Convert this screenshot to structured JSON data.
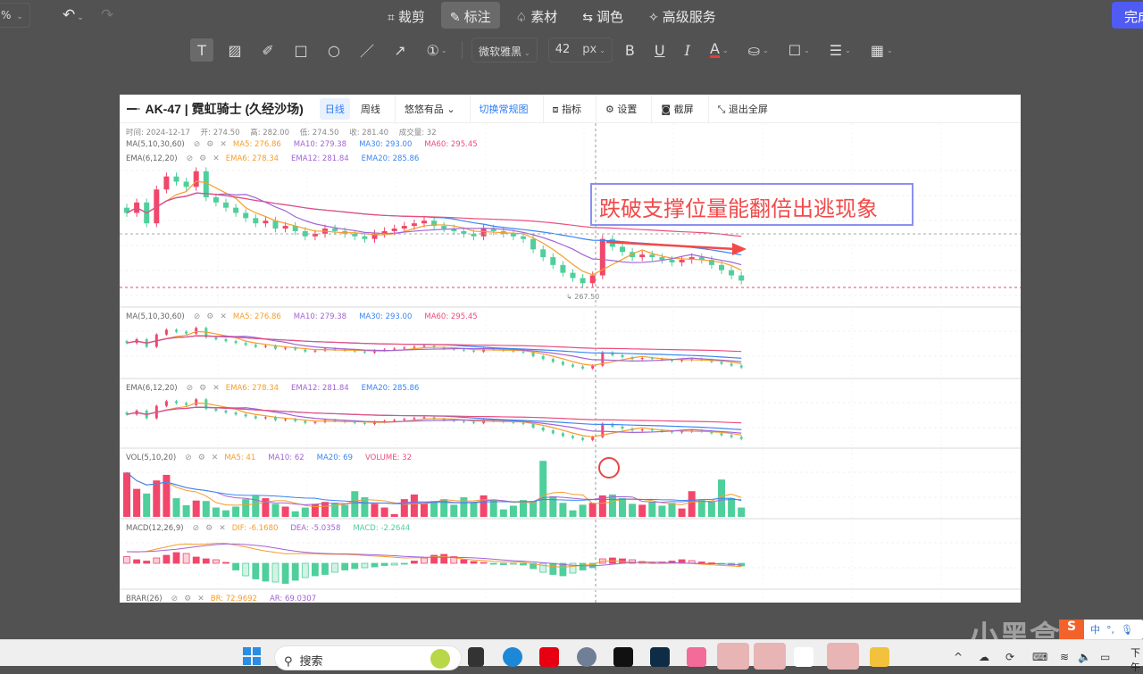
{
  "editor": {
    "zoom_value": "%",
    "modes": [
      {
        "icon": "crop-icon",
        "glyph": "⌗",
        "label": "裁剪",
        "active": false
      },
      {
        "icon": "annotate-icon",
        "glyph": "✎",
        "label": "标注",
        "active": true
      },
      {
        "icon": "material-icon",
        "glyph": "♤",
        "label": "素材",
        "active": false
      },
      {
        "icon": "adjust-color-icon",
        "glyph": "⇆",
        "label": "调色",
        "active": false
      },
      {
        "icon": "premium-icon",
        "glyph": "✧",
        "label": "高级服务",
        "active": false
      }
    ],
    "done_label": "完成",
    "tools": [
      {
        "name": "text-tool",
        "glyph": "T",
        "active": true
      },
      {
        "name": "image-tool",
        "glyph": "▨"
      },
      {
        "name": "brush-tool",
        "glyph": "✐"
      },
      {
        "name": "rectangle-tool",
        "glyph": "□"
      },
      {
        "name": "ellipse-tool",
        "glyph": "○"
      },
      {
        "name": "line-tool",
        "glyph": "／"
      },
      {
        "name": "arrow-tool",
        "glyph": "↗"
      },
      {
        "name": "number-tool",
        "glyph": "①"
      }
    ],
    "font_family": "微软雅黑",
    "font_size": "42",
    "font_unit": "px",
    "format": {
      "bold": "B",
      "underline": "U",
      "italic": "I",
      "color": "A",
      "text_color_hex": "#e83a3a"
    }
  },
  "chart_window": {
    "title": "AK-47 | 霓虹骑士 (久经沙场)",
    "tabs": [
      {
        "label": "日线",
        "active": true
      },
      {
        "label": "周线",
        "active": false
      }
    ],
    "source_select": "悠悠有品",
    "switch_view": "切换常规图",
    "toolbar": [
      {
        "icon": "indicator-icon",
        "glyph": "⧈",
        "label": "指标"
      },
      {
        "icon": "gear-icon",
        "glyph": "⚙",
        "label": "设置"
      },
      {
        "icon": "camera-icon",
        "glyph": "◙",
        "label": "截屏"
      },
      {
        "icon": "exit-fullscreen-icon",
        "glyph": "⤡",
        "label": "退出全屏"
      }
    ],
    "info": {
      "time": "时间: 2024-12-17",
      "open": "开: 274.50",
      "high": "高: 282.00",
      "low": "低: 274.50",
      "close": "收: 281.40",
      "volume": "成交量: 32"
    },
    "indicators": {
      "ma_main": {
        "name": "MA(5,10,30,60)",
        "values": [
          "MA5: 276.86",
          "MA10: 279.38",
          "MA30: 293.00",
          "MA60: 295.45"
        ]
      },
      "ema_main": {
        "name": "EMA(6,12,20)",
        "values": [
          "EMA6: 278.34",
          "EMA12: 281.84",
          "EMA20: 285.86"
        ]
      },
      "ma_panel": {
        "name": "MA(5,10,30,60)",
        "values": [
          "MA5: 276.86",
          "MA10: 279.38",
          "MA30: 293.00",
          "MA60: 295.45"
        ]
      },
      "ema_panel": {
        "name": "EMA(6,12,20)",
        "values": [
          "EMA6: 278.34",
          "EMA12: 281.84",
          "EMA20: 285.86"
        ]
      },
      "vol": {
        "name": "VOL(5,10,20)",
        "values": [
          "MA5: 41",
          "MA10: 62",
          "MA20: 69",
          "VOLUME: 32"
        ]
      },
      "macd": {
        "name": "MACD(12,26,9)",
        "values": [
          "DIF: -6.1680",
          "DEA: -5.0358",
          "MACD: -2.2644"
        ]
      },
      "brar": {
        "name": "BRAR(26)",
        "values": [
          "BR: 72.9692",
          "AR: 69.0307"
        ]
      }
    },
    "low_marker": "267.50",
    "annotation_text": "跌破支撑位量能翻倍出逃现象",
    "colors": {
      "up": "#f2466b",
      "down": "#4fcf9b",
      "ma5": "#f79d2a",
      "ma10": "#a264d6",
      "ma30": "#3a86f4",
      "ma60": "#ec4d7b",
      "annotation_border": "#8c90f2",
      "annotation_text": "#f24a4a"
    }
  },
  "chart_data": {
    "type": "candlestick",
    "title": "AK-47 | 霓虹骑士 (久经沙场)",
    "period": "日线",
    "close_series": [
      296,
      300,
      292,
      305,
      310,
      308,
      306,
      312,
      302,
      300,
      298,
      296,
      294,
      292,
      293,
      290,
      291,
      289,
      287,
      288,
      290,
      289,
      288,
      287,
      286,
      288,
      289,
      290,
      291,
      292,
      293,
      291,
      290,
      289,
      288,
      287,
      290,
      289,
      288,
      287,
      286,
      282,
      279,
      276,
      273,
      271,
      269,
      272,
      286,
      283,
      281,
      279,
      280,
      279,
      278,
      277,
      278,
      279,
      278,
      276,
      274,
      272,
      270
    ],
    "volume_series": [
      95,
      60,
      50,
      78,
      90,
      40,
      25,
      35,
      34,
      20,
      14,
      22,
      38,
      45,
      40,
      28,
      22,
      12,
      20,
      28,
      32,
      30,
      26,
      55,
      42,
      28,
      20,
      6,
      38,
      48,
      28,
      34,
      38,
      26,
      42,
      32,
      46,
      36,
      16,
      24,
      36,
      34,
      120,
      44,
      30,
      14,
      26,
      30,
      46,
      48,
      40,
      28,
      26,
      32,
      24,
      30,
      18,
      55,
      36,
      32,
      80,
      40,
      20
    ],
    "volume_highlight_value": 32,
    "macd_hist": [
      1.5,
      0.8,
      0.5,
      1.2,
      1.8,
      2.4,
      2.2,
      1.4,
      1,
      0.8,
      0.2,
      -1.5,
      -2.8,
      -3.5,
      -4,
      -4.2,
      -4.5,
      -3.8,
      -3.2,
      -2.8,
      -2.5,
      -2,
      -1.5,
      -1.2,
      -1,
      -0.8,
      -0.5,
      -0.4,
      -0.2,
      0.5,
      1.2,
      1.8,
      2,
      1.5,
      0.8,
      0.4,
      0.2,
      -0.2,
      -0.3,
      -0.2,
      -0.4,
      -1.2,
      -2,
      -2.5,
      -2.8,
      -2.2,
      -1.5,
      -1,
      1,
      1.2,
      1,
      0.8,
      0.4,
      0.2,
      0.3,
      0.5,
      0.8,
      0.6,
      0.3,
      0.1,
      -0.2,
      -0.4,
      -0.6
    ]
  },
  "taskbar": {
    "search_placeholder": "搜索",
    "tray_ime": "中",
    "clock": "下午",
    "watermark": "小黑盒"
  }
}
